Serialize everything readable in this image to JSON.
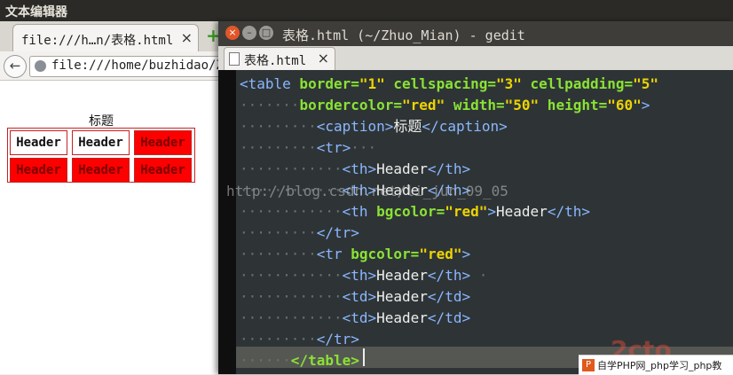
{
  "desktop": {
    "app_title": "文本编辑器"
  },
  "firefox": {
    "tab_title": "file:///h…n/表格.html",
    "tab_close": "×",
    "new_tab": "+",
    "back": "←",
    "url": "file:///home/buzhidao/Z",
    "page": {
      "caption": "标题",
      "rows": [
        [
          "Header",
          "Header",
          "Header"
        ],
        [
          "Header",
          "Header",
          "Header"
        ]
      ]
    }
  },
  "gedit": {
    "window_title": "表格.html (~/Zhuo_Mian) - gedit",
    "tab_title": "表格.html",
    "tab_close": "×",
    "win_close": "×",
    "win_min": "–",
    "win_max": "□"
  },
  "code": {
    "l1": {
      "ws": "",
      "t1": "<table",
      "a1": " border=",
      "v1": "\"1\"",
      "a2": " cellspacing=",
      "v2": "\"3\"",
      "a3": " cellpadding=",
      "v3": "\"5\""
    },
    "l2": {
      "ws": "·······",
      "a1": "bordercolor=",
      "v1": "\"red\"",
      "a2": " width=",
      "v2": "\"50\"",
      "a3": " height=",
      "v3": "\"60\"",
      "t1": ">"
    },
    "l3": {
      "ws": "·········",
      "t1": "<caption>",
      "x1": "标题",
      "t2": "</caption>"
    },
    "l4": {
      "ws": "·········",
      "t1": "<tr>",
      "ws2": "···"
    },
    "l5": {
      "ws": "············",
      "t1": "<th>",
      "x1": "Header",
      "t2": "</th>"
    },
    "l6": {
      "ws": "············",
      "t1": "<th>",
      "x1": "Header",
      "t2": "</th>"
    },
    "l7": {
      "ws": "············",
      "t1": "<th",
      "a1": " bgcolor=",
      "v1": "\"red\"",
      "t2": ">",
      "x1": "Header",
      "t3": "</th>"
    },
    "l8": {
      "ws": "·········",
      "t1": "</tr>"
    },
    "l9": {
      "ws": "·········",
      "t1": "<tr",
      "a1": " bgcolor=",
      "v1": "\"red\"",
      "t2": ">"
    },
    "l10": {
      "ws": "············",
      "t1": "<th>",
      "x1": "Header",
      "t2": "</th>",
      "ws2": " ·"
    },
    "l11": {
      "ws": "············",
      "t1": "<td>",
      "x1": "Header",
      "t2": "</td>"
    },
    "l12": {
      "ws": "············",
      "t1": "<td>",
      "x1": "Header",
      "t2": "</td>"
    },
    "l13": {
      "ws": "·········",
      "t1": "</tr>"
    },
    "l14": {
      "ws": "······",
      "t1": "</table>"
    }
  },
  "watermark": "http://blog.csdn.net/li_jun_09_05",
  "footer_badge": {
    "logo": "P",
    "text": "自学PHP网_php学习_php教"
  },
  "colors": {
    "tag": "#8ab7ff",
    "attr": "#8ae234",
    "value": "#edd400",
    "cell_red": "#ff0000",
    "border_red": "#c42323"
  }
}
